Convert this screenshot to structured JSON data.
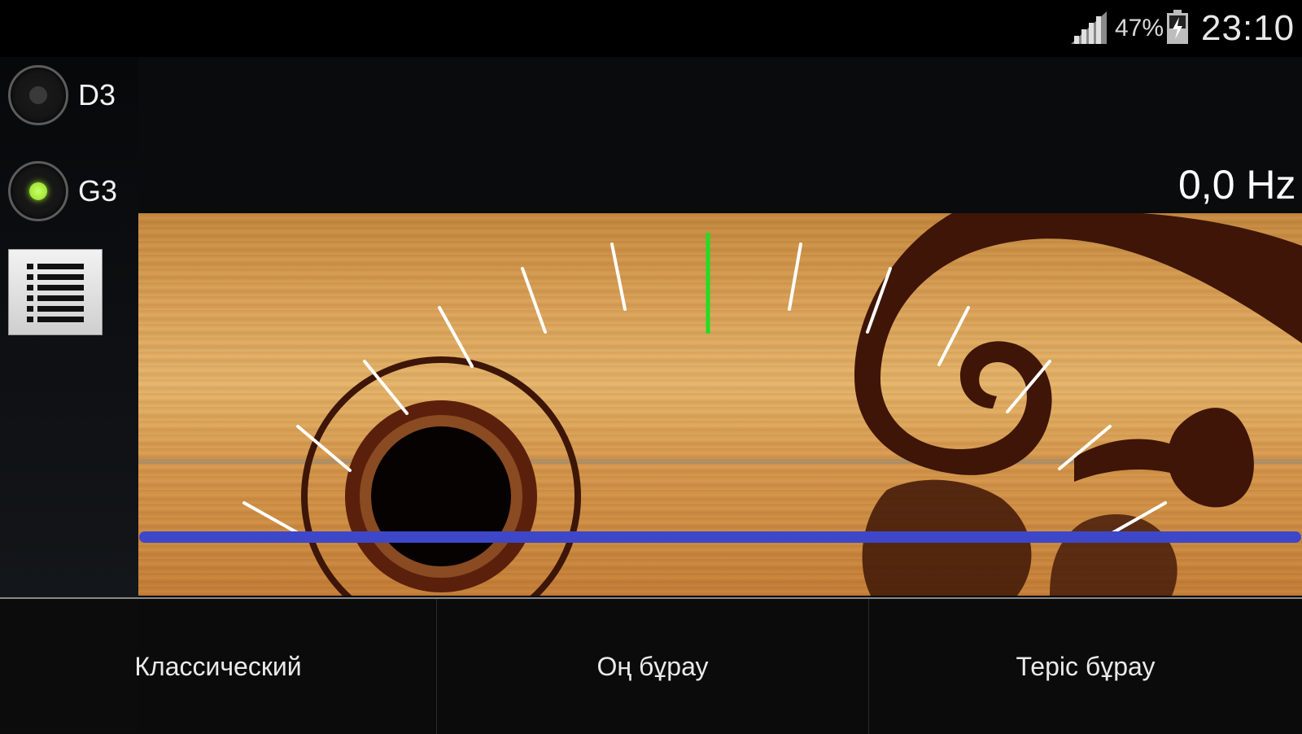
{
  "status_bar": {
    "battery_percent": "47%",
    "time": "23:10",
    "icons": [
      "signal-icon",
      "battery-charging-icon"
    ]
  },
  "strings": [
    {
      "label": "D3",
      "selected": false
    },
    {
      "label": "G3",
      "selected": true
    }
  ],
  "menu_icon": "list-icon",
  "frequency": "0,0 Hz",
  "tuner": {
    "needle_color": "#22dd22",
    "tick_color": "#ffffff",
    "baseline_color": "#3f47c9"
  },
  "tabs": [
    "Классический",
    "Оң бұрау",
    "Теріс бұрау"
  ]
}
